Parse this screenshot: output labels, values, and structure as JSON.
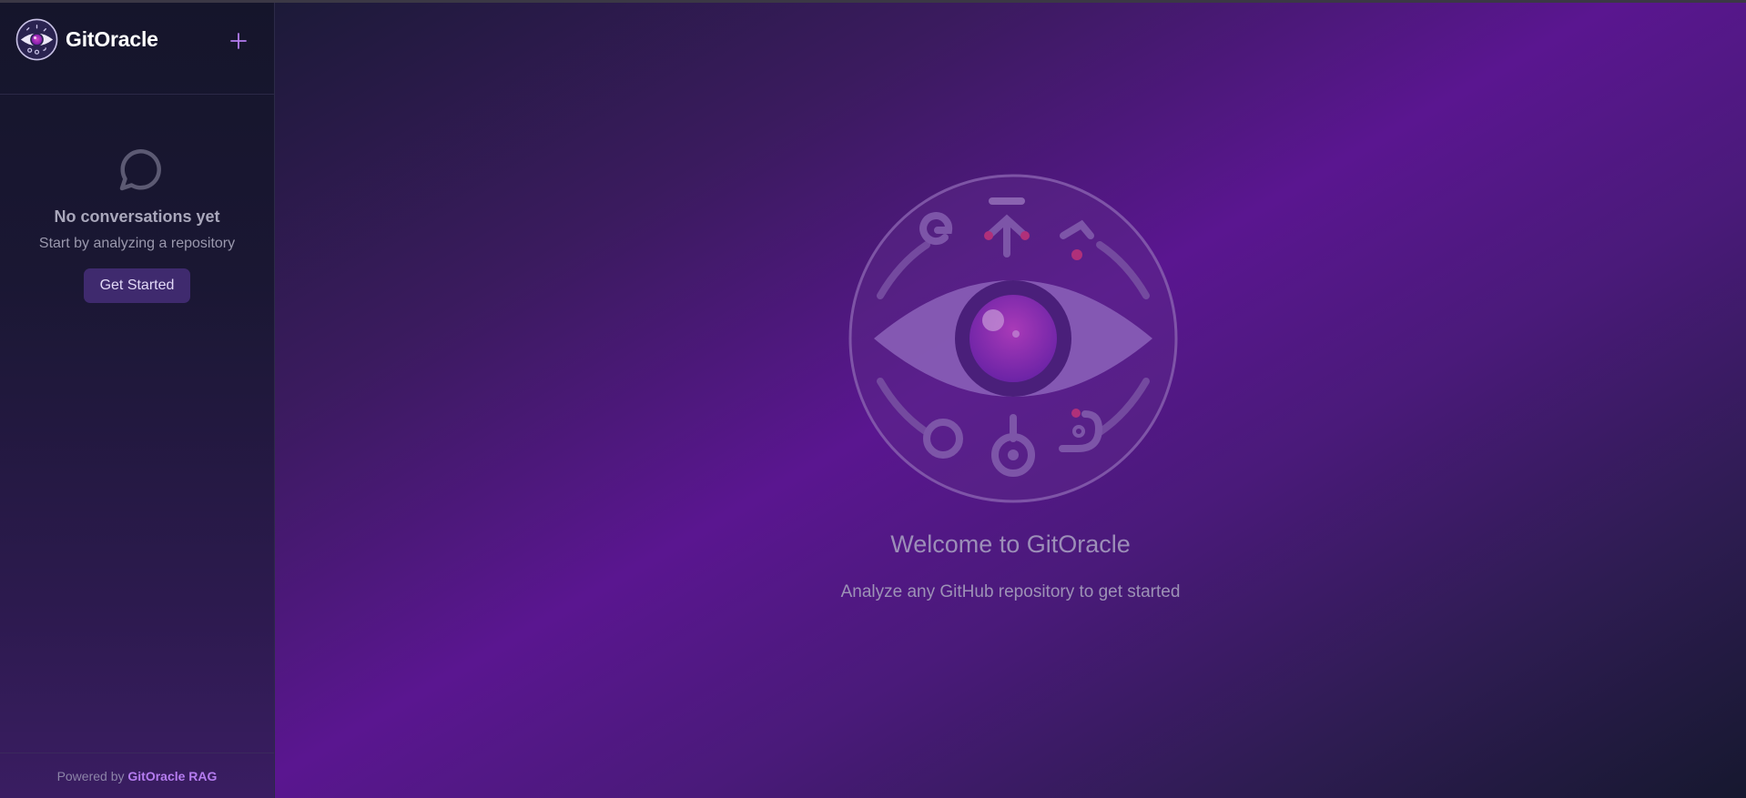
{
  "app": {
    "title": "GitOracle"
  },
  "sidebar": {
    "new_chat_icon": "plus-icon",
    "empty_state": {
      "icon": "chat-bubble-icon",
      "title": "No conversations yet",
      "subtitle": "Start by analyzing a repository",
      "button_label": "Get Started"
    },
    "footer": {
      "prefix": "Powered by",
      "link_label": "GitOracle RAG"
    }
  },
  "main": {
    "emblem_icon": "oracle-eye-emblem",
    "welcome_title": "Welcome to GitOracle",
    "welcome_subtitle": "Analyze any GitHub repository to get started"
  },
  "colors": {
    "accent": "#b57cf0",
    "button_bg": "#3f2a6e",
    "main_gradient_mid": "#5a1690",
    "sidebar_bg": "#15152b"
  }
}
